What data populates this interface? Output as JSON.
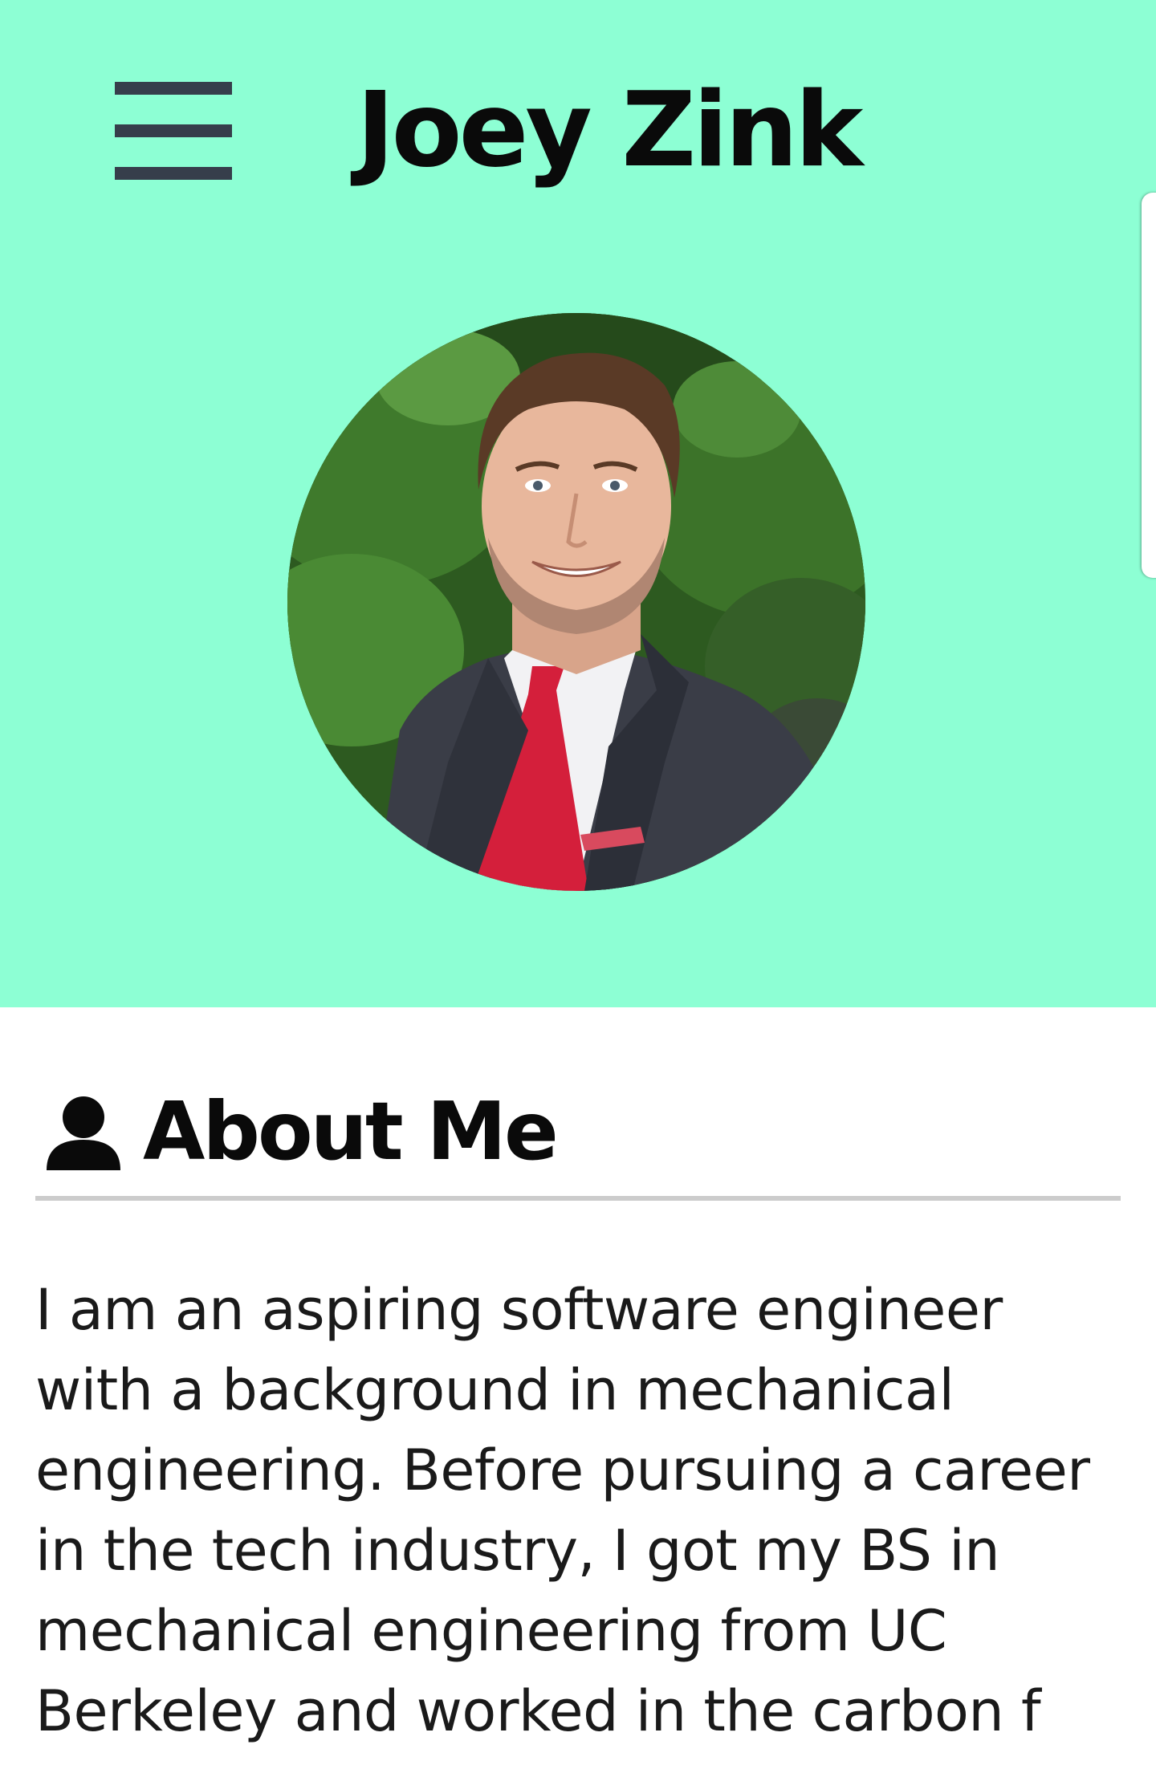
{
  "header": {
    "menu_icon": "hamburger-menu-icon",
    "site_title": "Joey Zink"
  },
  "profile": {
    "photo_alt": "Joey Zink"
  },
  "about": {
    "icon": "person-icon",
    "heading": "About Me",
    "body": "I am an aspiring software engineer with a background in mechanical engineering. Before pursuing a career in the tech industry, I got my BS in mechanical engineering from UC Berkeley and worked in the carbon f"
  },
  "colors": {
    "hero_background": "#8dffd4",
    "menu_icon": "#363e4b",
    "divider": "#cccccc",
    "text": "#0a0a0a"
  }
}
